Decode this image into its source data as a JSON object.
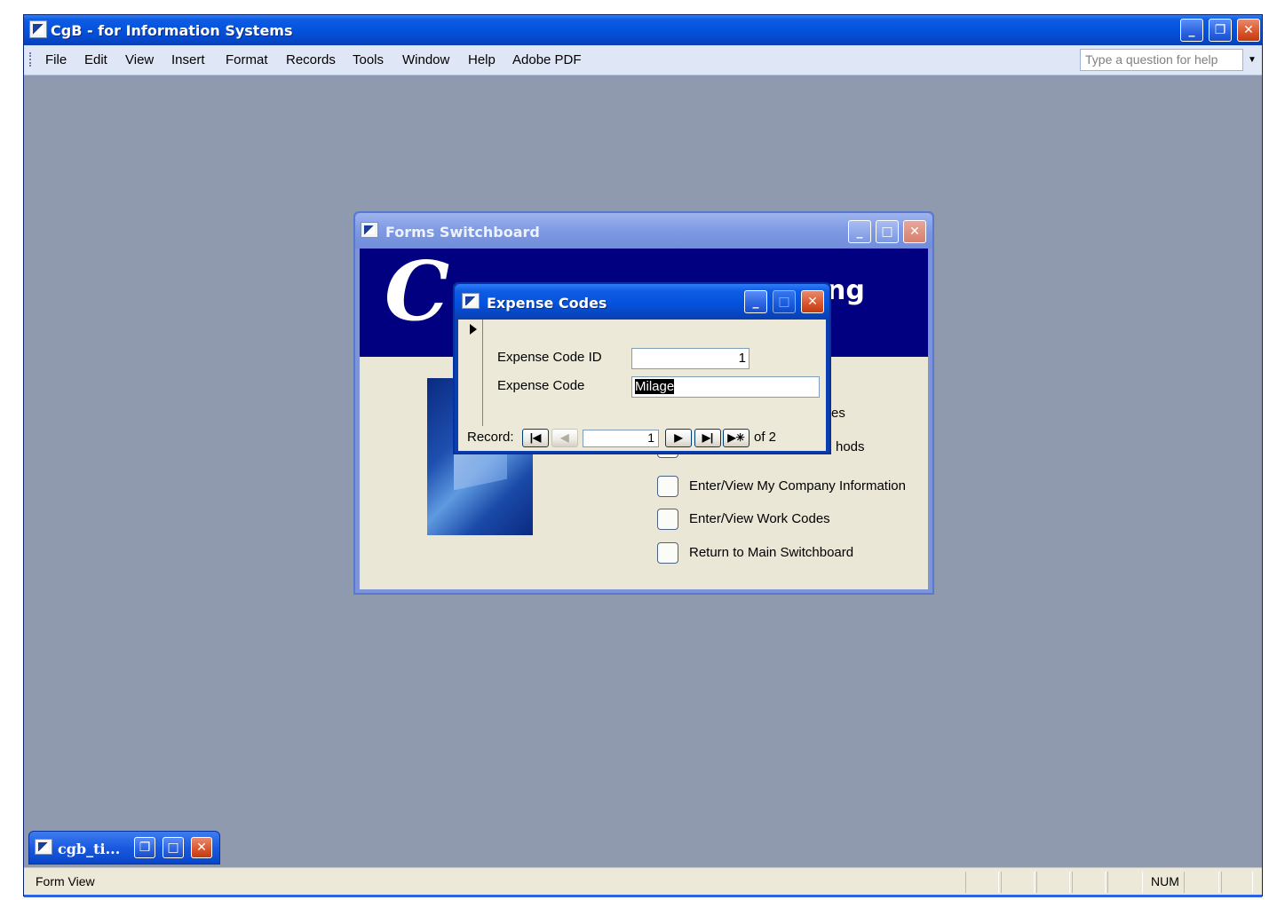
{
  "app": {
    "title": "CgB - for Information Systems",
    "icon": "access-form-icon",
    "menu": [
      "File",
      "Edit",
      "View",
      "Insert",
      "Format",
      "Records",
      "Tools",
      "Window",
      "Help",
      "Adobe PDF"
    ],
    "help_placeholder": "Type a question for help",
    "controls": {
      "minimize": "_",
      "restore": "❐",
      "close": "✕"
    }
  },
  "switchboard": {
    "title": "Forms Switchboard",
    "logo_text": "C",
    "banner_title_visible": "ng",
    "items": [
      {
        "label": "es"
      },
      {
        "label": "hods"
      },
      {
        "label": "Enter/View My Company Information"
      },
      {
        "label": "Enter/View Work Codes"
      },
      {
        "label": "Return to Main Switchboard"
      }
    ]
  },
  "expense_form": {
    "title": "Expense Codes",
    "fields": {
      "id_label": "Expense Code ID",
      "id_value": "1",
      "code_label": "Expense Code",
      "code_value": "Milage"
    },
    "navigation": {
      "record_label": "Record:",
      "current": "1",
      "of_text": "of  2",
      "first": "|◀",
      "prev": "◀",
      "next": "▶",
      "last": "▶|",
      "new": "▶✳"
    }
  },
  "minimized_window": {
    "title": "cgb_ti..."
  },
  "statusbar": {
    "mode": "Form View",
    "num": "NUM"
  },
  "colors": {
    "title_bar": "#0453dd",
    "mdi_background": "#8f9aae",
    "banner": "#000080",
    "form_face": "#ece9d8"
  }
}
